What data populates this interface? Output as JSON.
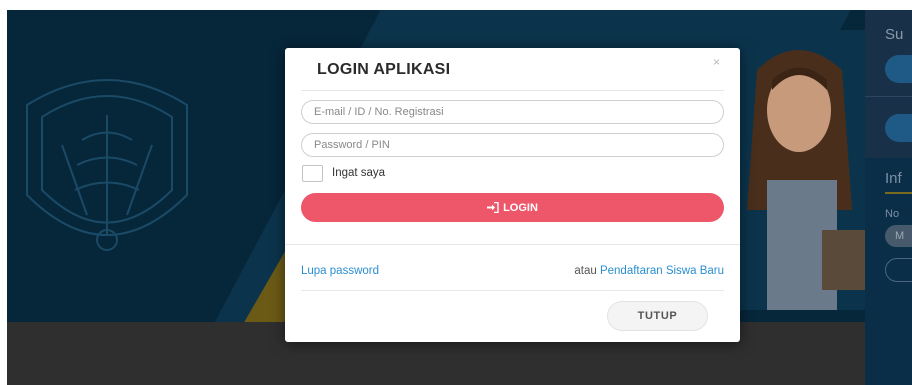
{
  "background": {
    "right_panel": {
      "title": "Su",
      "info_title": "Inf",
      "label": "No",
      "pill": "M"
    }
  },
  "modal": {
    "title": "LOGIN APLIKASI",
    "close_symbol": "×",
    "email_placeholder": "E-mail / ID / No. Registrasi",
    "email_value": "",
    "password_placeholder": "Password / PIN",
    "password_value": "",
    "remember_label": "Ingat saya",
    "remember_checked": false,
    "login_icon": "sign-in-icon",
    "login_label": "LOGIN",
    "forgot_label": "Lupa password",
    "register_prefix": "atau",
    "register_label": "Pendaftaran Siswa Baru",
    "close_button_label": "TUTUP"
  },
  "colors": {
    "login_button": "#ee5669",
    "link": "#2a8fd0",
    "hero_bg": "#06263a"
  }
}
